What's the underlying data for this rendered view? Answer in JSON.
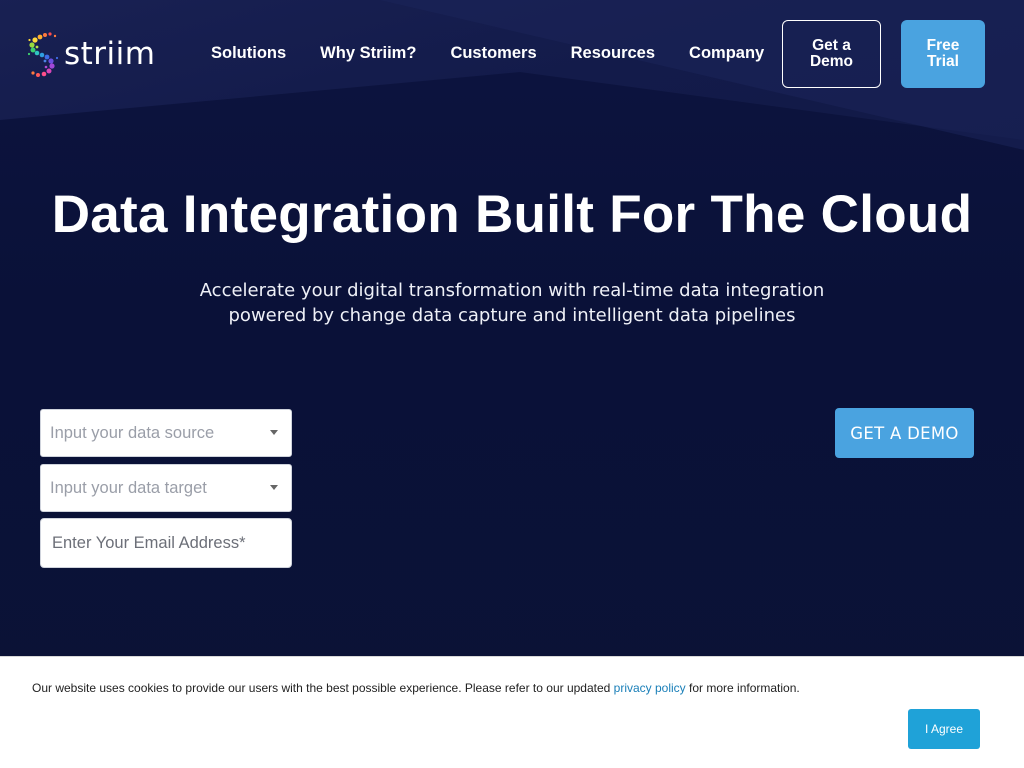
{
  "header": {
    "logo_text": "striim",
    "nav": [
      "Solutions",
      "Why Striim?",
      "Customers",
      "Resources",
      "Company"
    ],
    "get_demo_label": "Get a Demo",
    "free_trial_label": "Free Trial"
  },
  "hero": {
    "title": "Data Integration Built For The Cloud",
    "subtitle_line1": "Accelerate your digital transformation with real-time data integration",
    "subtitle_line2": "powered by change data capture and intelligent data pipelines"
  },
  "form": {
    "source_placeholder": "Input your data source",
    "target_placeholder": "Input your data target",
    "email_placeholder": "Enter Your Email Address*",
    "submit_label": "GET A DEMO"
  },
  "cookie": {
    "text_before": "Our website uses cookies to provide our users with the best possible experience. Please refer to our updated ",
    "link_text": "privacy policy",
    "text_after": " for more information.",
    "agree_label": "I Agree"
  },
  "colors": {
    "accent": "#4aa3e0",
    "background": "#0a1036",
    "cookie_button": "#1fa2d8",
    "link": "#1a7fb8"
  }
}
